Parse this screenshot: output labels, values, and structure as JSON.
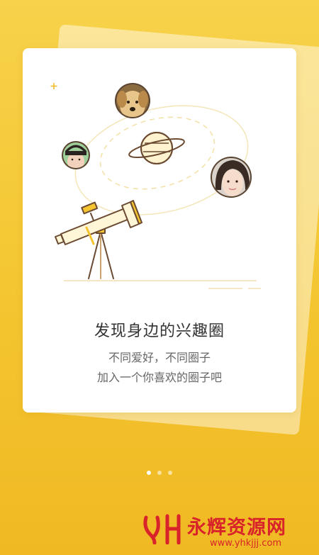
{
  "onboarding": {
    "title": "发现身边的兴趣圈",
    "subtitle_line1": "不同爱好，不同圈子",
    "subtitle_line2": "加入一个你喜欢的圈子吧",
    "pagination": {
      "current": 1,
      "total": 3
    }
  },
  "colors": {
    "background": "#f4c530",
    "accent": "#f0b923",
    "card": "#ffffff",
    "watermark": "#d8232a"
  },
  "illustration": {
    "icons": [
      "telescope-icon",
      "planet-icon",
      "dog-avatar",
      "girl-avatar",
      "woman-avatar",
      "sparkle-icon"
    ]
  },
  "watermark": {
    "brand": "永辉资源网",
    "url": "www.yhkjjj.com"
  }
}
